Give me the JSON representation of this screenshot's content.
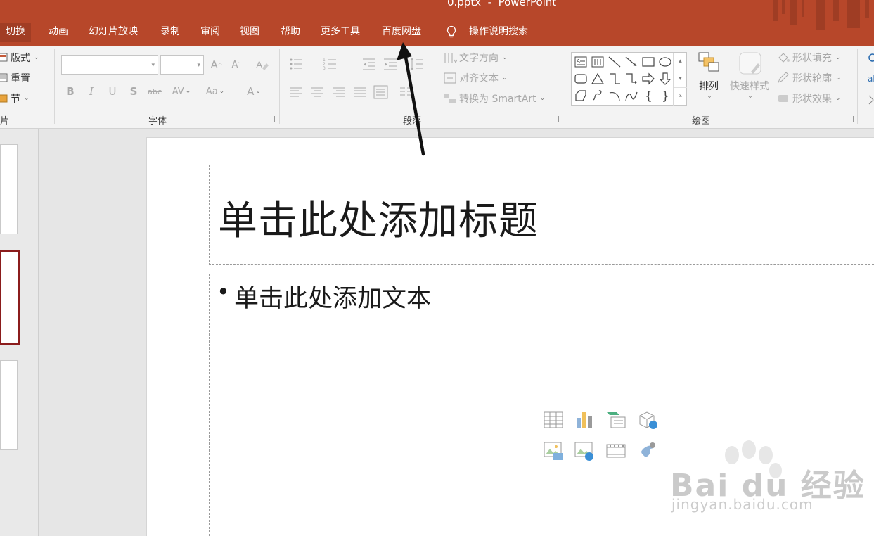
{
  "window": {
    "title": "0.pptx  -  PowerPoint"
  },
  "tabs": [
    {
      "label": "切换",
      "selected": true
    },
    {
      "label": "动画"
    },
    {
      "label": "幻灯片放映"
    },
    {
      "label": "录制"
    },
    {
      "label": "审阅"
    },
    {
      "label": "视图"
    },
    {
      "label": "帮助"
    },
    {
      "label": "更多工具"
    },
    {
      "label": "百度网盘"
    }
  ],
  "tell_me": {
    "label": "操作说明搜索",
    "icon": "lightbulb-icon"
  },
  "ribbon": {
    "slides_group": {
      "layout": "版式",
      "reset": "重置",
      "section": "节",
      "label": "片"
    },
    "font_group": {
      "label": "字体"
    },
    "paragraph_group": {
      "label": "段落",
      "text_direction": "文字方向",
      "align_text": "对齐文本",
      "smartart": "转换为 SmartArt"
    },
    "drawing_group": {
      "label": "绘图",
      "arrange": "排列",
      "quick_styles": "快速样式",
      "shape_fill": "形状填充",
      "shape_outline": "形状轮廓",
      "shape_effects": "形状效果"
    }
  },
  "slide": {
    "title_placeholder": "单击此处添加标题",
    "body_placeholder": "单击此处添加文本",
    "bullet": "•"
  },
  "watermark": {
    "brand": "Bai du 经验",
    "url": "jingyan.baidu.com"
  },
  "colors": {
    "accent": "#b7472a",
    "selected_thumb": "#8b1c1c"
  }
}
